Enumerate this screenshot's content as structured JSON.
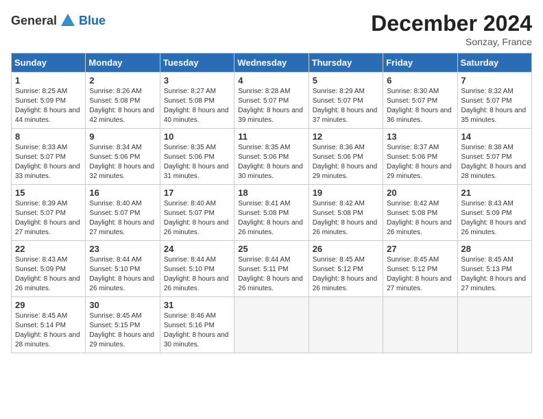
{
  "header": {
    "logo_general": "General",
    "logo_blue": "Blue",
    "month": "December 2024",
    "location": "Sonzay, France"
  },
  "weekdays": [
    "Sunday",
    "Monday",
    "Tuesday",
    "Wednesday",
    "Thursday",
    "Friday",
    "Saturday"
  ],
  "weeks": [
    [
      {
        "day": "1",
        "sunrise": "Sunrise: 8:25 AM",
        "sunset": "Sunset: 5:09 PM",
        "daylight": "Daylight: 8 hours and 44 minutes."
      },
      {
        "day": "2",
        "sunrise": "Sunrise: 8:26 AM",
        "sunset": "Sunset: 5:08 PM",
        "daylight": "Daylight: 8 hours and 42 minutes."
      },
      {
        "day": "3",
        "sunrise": "Sunrise: 8:27 AM",
        "sunset": "Sunset: 5:08 PM",
        "daylight": "Daylight: 8 hours and 40 minutes."
      },
      {
        "day": "4",
        "sunrise": "Sunrise: 8:28 AM",
        "sunset": "Sunset: 5:07 PM",
        "daylight": "Daylight: 8 hours and 39 minutes."
      },
      {
        "day": "5",
        "sunrise": "Sunrise: 8:29 AM",
        "sunset": "Sunset: 5:07 PM",
        "daylight": "Daylight: 8 hours and 37 minutes."
      },
      {
        "day": "6",
        "sunrise": "Sunrise: 8:30 AM",
        "sunset": "Sunset: 5:07 PM",
        "daylight": "Daylight: 8 hours and 36 minutes."
      },
      {
        "day": "7",
        "sunrise": "Sunrise: 8:32 AM",
        "sunset": "Sunset: 5:07 PM",
        "daylight": "Daylight: 8 hours and 35 minutes."
      }
    ],
    [
      {
        "day": "8",
        "sunrise": "Sunrise: 8:33 AM",
        "sunset": "Sunset: 5:07 PM",
        "daylight": "Daylight: 8 hours and 33 minutes."
      },
      {
        "day": "9",
        "sunrise": "Sunrise: 8:34 AM",
        "sunset": "Sunset: 5:06 PM",
        "daylight": "Daylight: 8 hours and 32 minutes."
      },
      {
        "day": "10",
        "sunrise": "Sunrise: 8:35 AM",
        "sunset": "Sunset: 5:06 PM",
        "daylight": "Daylight: 8 hours and 31 minutes."
      },
      {
        "day": "11",
        "sunrise": "Sunrise: 8:35 AM",
        "sunset": "Sunset: 5:06 PM",
        "daylight": "Daylight: 8 hours and 30 minutes."
      },
      {
        "day": "12",
        "sunrise": "Sunrise: 8:36 AM",
        "sunset": "Sunset: 5:06 PM",
        "daylight": "Daylight: 8 hours and 29 minutes."
      },
      {
        "day": "13",
        "sunrise": "Sunrise: 8:37 AM",
        "sunset": "Sunset: 5:06 PM",
        "daylight": "Daylight: 8 hours and 29 minutes."
      },
      {
        "day": "14",
        "sunrise": "Sunrise: 8:38 AM",
        "sunset": "Sunset: 5:07 PM",
        "daylight": "Daylight: 8 hours and 28 minutes."
      }
    ],
    [
      {
        "day": "15",
        "sunrise": "Sunrise: 8:39 AM",
        "sunset": "Sunset: 5:07 PM",
        "daylight": "Daylight: 8 hours and 27 minutes."
      },
      {
        "day": "16",
        "sunrise": "Sunrise: 8:40 AM",
        "sunset": "Sunset: 5:07 PM",
        "daylight": "Daylight: 8 hours and 27 minutes."
      },
      {
        "day": "17",
        "sunrise": "Sunrise: 8:40 AM",
        "sunset": "Sunset: 5:07 PM",
        "daylight": "Daylight: 8 hours and 26 minutes."
      },
      {
        "day": "18",
        "sunrise": "Sunrise: 8:41 AM",
        "sunset": "Sunset: 5:08 PM",
        "daylight": "Daylight: 8 hours and 26 minutes."
      },
      {
        "day": "19",
        "sunrise": "Sunrise: 8:42 AM",
        "sunset": "Sunset: 5:08 PM",
        "daylight": "Daylight: 8 hours and 26 minutes."
      },
      {
        "day": "20",
        "sunrise": "Sunrise: 8:42 AM",
        "sunset": "Sunset: 5:08 PM",
        "daylight": "Daylight: 8 hours and 26 minutes."
      },
      {
        "day": "21",
        "sunrise": "Sunrise: 8:43 AM",
        "sunset": "Sunset: 5:09 PM",
        "daylight": "Daylight: 8 hours and 26 minutes."
      }
    ],
    [
      {
        "day": "22",
        "sunrise": "Sunrise: 8:43 AM",
        "sunset": "Sunset: 5:09 PM",
        "daylight": "Daylight: 8 hours and 26 minutes."
      },
      {
        "day": "23",
        "sunrise": "Sunrise: 8:44 AM",
        "sunset": "Sunset: 5:10 PM",
        "daylight": "Daylight: 8 hours and 26 minutes."
      },
      {
        "day": "24",
        "sunrise": "Sunrise: 8:44 AM",
        "sunset": "Sunset: 5:10 PM",
        "daylight": "Daylight: 8 hours and 26 minutes."
      },
      {
        "day": "25",
        "sunrise": "Sunrise: 8:44 AM",
        "sunset": "Sunset: 5:11 PM",
        "daylight": "Daylight: 8 hours and 26 minutes."
      },
      {
        "day": "26",
        "sunrise": "Sunrise: 8:45 AM",
        "sunset": "Sunset: 5:12 PM",
        "daylight": "Daylight: 8 hours and 26 minutes."
      },
      {
        "day": "27",
        "sunrise": "Sunrise: 8:45 AM",
        "sunset": "Sunset: 5:12 PM",
        "daylight": "Daylight: 8 hours and 27 minutes."
      },
      {
        "day": "28",
        "sunrise": "Sunrise: 8:45 AM",
        "sunset": "Sunset: 5:13 PM",
        "daylight": "Daylight: 8 hours and 27 minutes."
      }
    ],
    [
      {
        "day": "29",
        "sunrise": "Sunrise: 8:45 AM",
        "sunset": "Sunset: 5:14 PM",
        "daylight": "Daylight: 8 hours and 28 minutes."
      },
      {
        "day": "30",
        "sunrise": "Sunrise: 8:45 AM",
        "sunset": "Sunset: 5:15 PM",
        "daylight": "Daylight: 8 hours and 29 minutes."
      },
      {
        "day": "31",
        "sunrise": "Sunrise: 8:46 AM",
        "sunset": "Sunset: 5:16 PM",
        "daylight": "Daylight: 8 hours and 30 minutes."
      },
      null,
      null,
      null,
      null
    ]
  ]
}
